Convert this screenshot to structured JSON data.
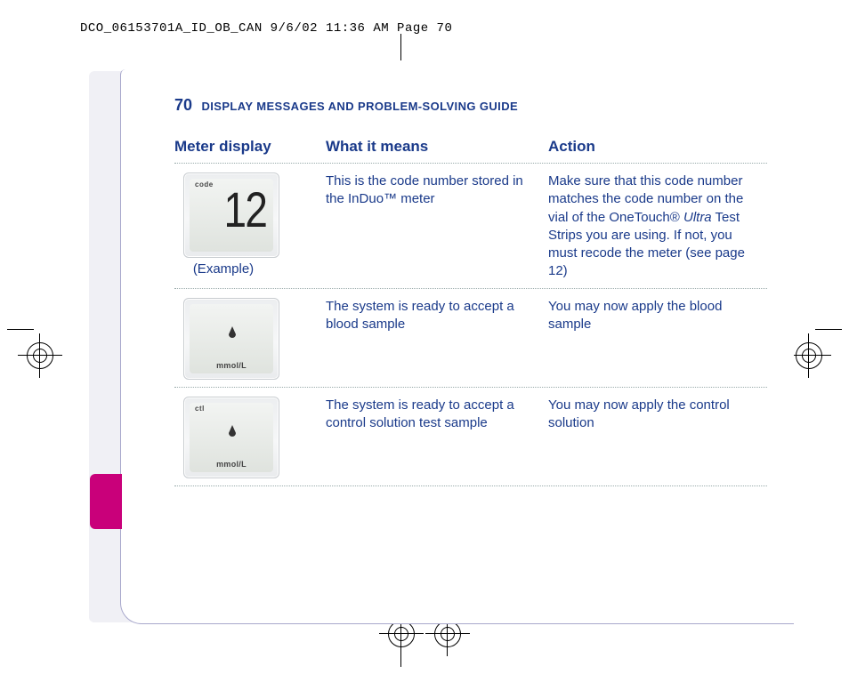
{
  "print_header": "DCO_06153701A_ID_OB_CAN  9/6/02  11:36 AM  Page 70",
  "page_number": "70",
  "section_title": "DISPLAY MESSAGES AND PROBLEM-SOLVING GUIDE",
  "columns": {
    "col1": "Meter display",
    "col2": "What it means",
    "col3": "Action"
  },
  "rows": [
    {
      "display": {
        "code_label": "code",
        "big": "12",
        "caption": "(Example)"
      },
      "meaning": "This is the code number stored in the InDuo™ meter",
      "action_pre": "Make sure that this code number matches the code number on the vial of the OneTouch® ",
      "action_italic": "Ultra",
      "action_post": " Test Strips you are using. If not, you must recode the meter (see page 12)"
    },
    {
      "display": {
        "drop": "▲",
        "units": "mmol/L"
      },
      "meaning": "The system is ready to accept a blood sample",
      "action": "You may now apply the blood sample"
    },
    {
      "display": {
        "ctl_label": "ctl",
        "drop": "▲",
        "units": "mmol/L"
      },
      "meaning": "The system is ready to accept a control solution test sample",
      "action": "You may now apply the control solution"
    }
  ]
}
